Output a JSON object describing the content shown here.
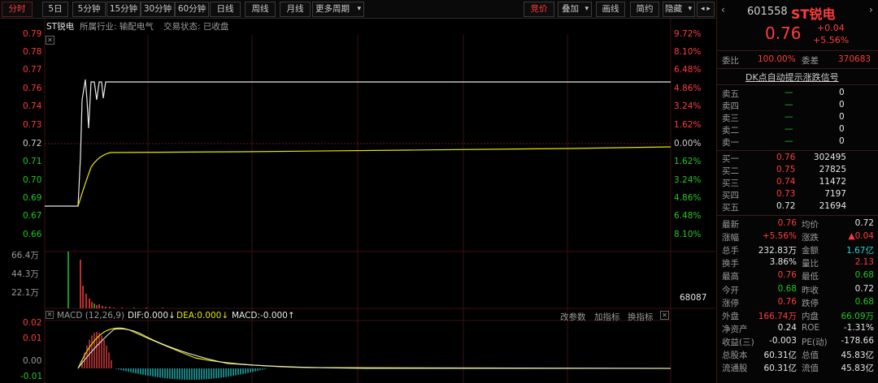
{
  "toolbar": {
    "tabs": [
      "分时",
      "5日",
      "5分钟",
      "15分钟",
      "30分钟",
      "60分钟",
      "日线",
      "周线",
      "月线",
      "更多周期"
    ],
    "right": [
      "竞价",
      "叠加",
      "画线",
      "简约",
      "隐藏"
    ],
    "more_arrow": "▾",
    "nav": "◂ ▸"
  },
  "stock": {
    "code": "601558",
    "name": "ST锐电",
    "price": "0.76",
    "change": "+0.04",
    "change_pct": "+5.56%",
    "nav_left": "‹",
    "nav_right": "›"
  },
  "chart_header": {
    "name": "ST锐电",
    "industry": "所属行业: 输配电气",
    "status": "交易状态: 已收盘"
  },
  "price_axis": {
    "left": [
      "0.79",
      "0.78",
      "0.77",
      "0.76",
      "0.74",
      "0.73",
      "0.72",
      "0.71",
      "0.70",
      "0.69",
      "0.67",
      "0.66"
    ],
    "right": [
      "9.72%",
      "8.10%",
      "6.48%",
      "4.86%",
      "3.24%",
      "1.62%",
      "0.00%",
      "1.62%",
      "3.24%",
      "4.86%",
      "6.48%",
      "8.10%"
    ]
  },
  "volume_axis": {
    "left": [
      "66.4万",
      "44.3万",
      "22.1万"
    ],
    "last": "68087"
  },
  "macd": {
    "title": "MACD (12,26,9)",
    "dif": "DIF:0.000↓",
    "dea": "DEA:0.000↓",
    "macd": "MACD:-0.000↑",
    "buttons": [
      "改参数",
      "加指标",
      "换指标"
    ],
    "axis": [
      "0.02",
      "0.01",
      "0.00",
      "-0.01"
    ]
  },
  "wb": {
    "label": "委比",
    "pct": "100.00%",
    "diff_label": "委差",
    "diff": "370683"
  },
  "link": "DK点自动提示涨跌信号",
  "sell": [
    {
      "label": "卖五",
      "price": "—",
      "vol": "0"
    },
    {
      "label": "卖四",
      "price": "—",
      "vol": "0"
    },
    {
      "label": "卖三",
      "price": "—",
      "vol": "0"
    },
    {
      "label": "卖二",
      "price": "—",
      "vol": "0"
    },
    {
      "label": "卖一",
      "price": "—",
      "vol": "0"
    }
  ],
  "buy": [
    {
      "label": "买一",
      "price": "0.76",
      "vol": "302495"
    },
    {
      "label": "买二",
      "price": "0.75",
      "vol": "27825"
    },
    {
      "label": "买三",
      "price": "0.74",
      "vol": "11472"
    },
    {
      "label": "买四",
      "price": "0.73",
      "vol": "7197"
    },
    {
      "label": "买五",
      "price": "0.72",
      "vol": "21694"
    }
  ],
  "stats": [
    {
      "l1": "最新",
      "v1": "0.76",
      "l2": "均价",
      "v2": "0.72"
    },
    {
      "l1": "涨幅",
      "v1": "+5.56%",
      "l2": "涨跌",
      "v2": "▲0.04"
    },
    {
      "l1": "总手",
      "v1": "232.83万",
      "l2": "金额",
      "v2": "1.67亿"
    },
    {
      "l1": "换手",
      "v1": "3.86%",
      "l2": "量比",
      "v2": "2.13"
    },
    {
      "l1": "最高",
      "v1": "0.76",
      "l2": "最低",
      "v2": "0.68"
    },
    {
      "l1": "今开",
      "v1": "0.68",
      "l2": "昨收",
      "v2": "0.72"
    },
    {
      "l1": "涨停",
      "v1": "0.76",
      "l2": "跌停",
      "v2": "0.68"
    },
    {
      "l1": "外盘",
      "v1": "166.74万",
      "l2": "内盘",
      "v2": "66.09万"
    },
    {
      "l1": "净资产",
      "v1": "0.24",
      "l2": "ROE",
      "v2": "-1.31%"
    },
    {
      "l1": "收益(三)",
      "v1": "-0.003",
      "l2": "PE(动)",
      "v2": "-178.66"
    },
    {
      "l1": "总股本",
      "v1": "60.31亿",
      "l2": "总值",
      "v2": "45.83亿"
    },
    {
      "l1": "流通股",
      "v1": "60.31亿",
      "l2": "流值",
      "v2": "45.83亿"
    }
  ],
  "colors": {
    "up": "#ff3c3c",
    "down": "#21c821",
    "price_line": "#e8e8e8",
    "avg_line": "#e6e600",
    "grid": "#3a1212"
  }
}
